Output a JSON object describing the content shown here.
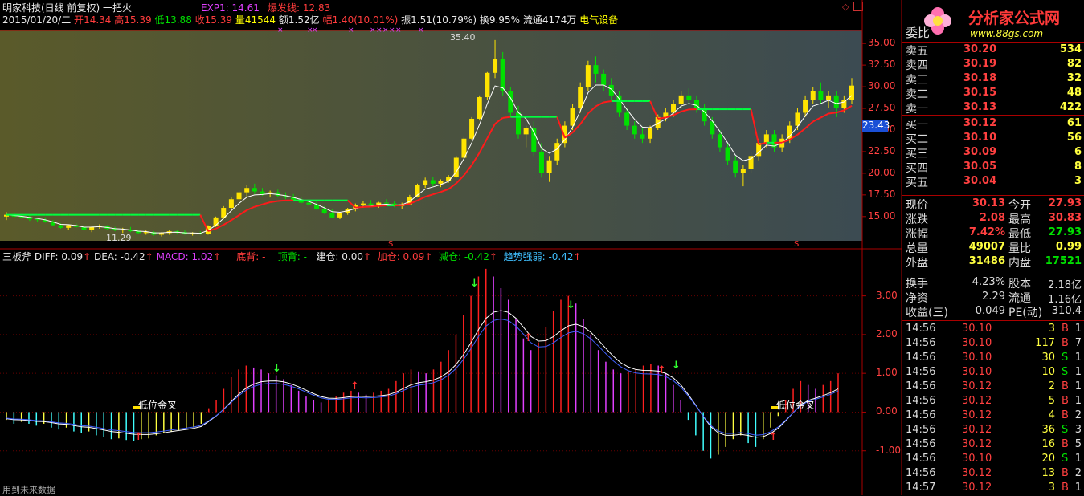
{
  "header": {
    "title": "明家科技(日线 前复权) 一把火",
    "date": "2015/01/20/二",
    "open_label": "开",
    "open": "14.34",
    "high_label": "高",
    "high": "15.39",
    "low_label": "低",
    "low": "13.88",
    "close_label": "收",
    "close": "15.39",
    "vol_label": "量",
    "vol": "41544",
    "amt_label": "额",
    "amt": "1.52亿",
    "chg_label": "幅",
    "chg": "1.40(10.01%)",
    "amp_label": "振",
    "amp": "1.51(10.79%)",
    "turn_label": "换",
    "turn": "9.95%",
    "float_label": "流通",
    "float": "4174万",
    "sector": "电气设备",
    "exp1": "EXP1: 14.61",
    "burst": "爆发线: 12.83"
  },
  "price_chart": {
    "y_ticks": [
      "35.00",
      "32.50",
      "30.00",
      "27.50",
      "25.00",
      "22.50",
      "20.00",
      "17.50",
      "15.00"
    ],
    "current_tag": "23.43",
    "max_label": "35.40",
    "min_label": "11.29",
    "candles": [
      [
        15,
        15.5,
        14.6,
        15.2
      ],
      [
        15.2,
        15.5,
        14.8,
        15
      ],
      [
        15,
        15.3,
        14.7,
        14.9
      ],
      [
        14.9,
        15.1,
        14.5,
        14.7
      ],
      [
        14.7,
        14.9,
        14.4,
        14.6
      ],
      [
        14.6,
        14.9,
        14.3,
        14.4
      ],
      [
        14.4,
        14.6,
        13.9,
        14.0
      ],
      [
        14,
        14.2,
        13.6,
        13.7
      ],
      [
        13.7,
        14.1,
        13.5,
        14.0
      ],
      [
        14,
        14.2,
        13.7,
        13.8
      ],
      [
        13.8,
        14.0,
        13.4,
        13.5
      ],
      [
        13.5,
        13.9,
        13.2,
        13.8
      ],
      [
        13.8,
        14.1,
        13.6,
        13.9
      ],
      [
        13.9,
        14.0,
        13.5,
        13.6
      ],
      [
        13.6,
        13.8,
        13.3,
        13.4
      ],
      [
        13.4,
        13.7,
        13.1,
        13.5
      ],
      [
        13.5,
        13.8,
        13.2,
        13.3
      ],
      [
        13.3,
        13.5,
        13.0,
        13.1
      ],
      [
        13.1,
        13.4,
        12.9,
        13.2
      ],
      [
        13.2,
        13.3,
        12.8,
        12.9
      ],
      [
        12.9,
        13.2,
        12.7,
        13.1
      ],
      [
        13.1,
        13.4,
        12.9,
        13.3
      ],
      [
        13.3,
        13.5,
        13.0,
        13.2
      ],
      [
        13.2,
        13.4,
        12.9,
        13.0
      ],
      [
        13,
        13.2,
        12.8,
        13.1
      ],
      [
        13.1,
        13.3,
        12.9,
        13.0
      ],
      [
        13.0,
        14.0,
        12.9,
        13.9
      ],
      [
        13.9,
        15.0,
        13.8,
        14.9
      ],
      [
        14.9,
        16.2,
        14.7,
        16.0
      ],
      [
        16,
        17.2,
        15.8,
        17.0
      ],
      [
        17,
        18.0,
        16.5,
        17.8
      ],
      [
        17.8,
        18.6,
        17.2,
        18.3
      ],
      [
        18.3,
        18.8,
        17.6,
        17.9
      ],
      [
        17.9,
        18.3,
        17.4,
        17.6
      ],
      [
        17.6,
        18.0,
        17.2,
        17.8
      ],
      [
        17.8,
        18.1,
        17.3,
        17.4
      ],
      [
        17.4,
        17.8,
        17.0,
        17.2
      ],
      [
        17.2,
        17.6,
        16.8,
        16.9
      ],
      [
        16.9,
        17.3,
        16.5,
        16.6
      ],
      [
        16.6,
        17.0,
        16.2,
        16.4
      ],
      [
        16.4,
        16.8,
        15.8,
        15.9
      ],
      [
        15.9,
        16.2,
        15.3,
        15.4
      ],
      [
        15.4,
        15.8,
        14.8,
        14.9
      ],
      [
        14.9,
        15.5,
        14.7,
        15.4
      ],
      [
        15.4,
        16.0,
        15.2,
        15.9
      ],
      [
        15.9,
        16.5,
        15.6,
        16.3
      ],
      [
        16.3,
        16.8,
        16.0,
        16.5
      ],
      [
        16.5,
        16.9,
        16.1,
        16.3
      ],
      [
        16.3,
        16.7,
        16.0,
        16.6
      ],
      [
        16.6,
        17.0,
        16.3,
        16.5
      ],
      [
        16.5,
        16.8,
        16.1,
        16.2
      ],
      [
        16.2,
        16.6,
        15.9,
        16.4
      ],
      [
        16.4,
        17.5,
        16.3,
        17.3
      ],
      [
        17.3,
        18.8,
        17.2,
        18.6
      ],
      [
        18.6,
        19.5,
        18.3,
        19.2
      ],
      [
        19.2,
        19.6,
        18.5,
        18.8
      ],
      [
        18.8,
        19.3,
        18.4,
        19.1
      ],
      [
        19.1,
        19.8,
        18.9,
        19.6
      ],
      [
        19.6,
        22.0,
        19.5,
        21.8
      ],
      [
        21.8,
        24.2,
        21.6,
        24.0
      ],
      [
        24,
        26.5,
        23.8,
        26.3
      ],
      [
        26.3,
        29.0,
        26.1,
        28.8
      ],
      [
        28.8,
        31.7,
        28.5,
        31.6
      ],
      [
        31.6,
        35.4,
        31.0,
        33.2
      ],
      [
        33.2,
        34.0,
        29.0,
        29.5
      ],
      [
        29.5,
        30.0,
        26.5,
        27.0
      ],
      [
        27,
        27.8,
        24.0,
        24.5
      ],
      [
        24.5,
        25.5,
        23.0,
        25.2
      ],
      [
        25.2,
        26.0,
        22.0,
        22.5
      ],
      [
        22.5,
        23.5,
        19.5,
        20.0
      ],
      [
        20,
        22.0,
        19.0,
        21.5
      ],
      [
        21.5,
        24.0,
        21.0,
        23.5
      ],
      [
        23.5,
        26.0,
        23.0,
        25.5
      ],
      [
        25.5,
        28.0,
        25.0,
        27.5
      ],
      [
        27.5,
        30.5,
        27.0,
        30.0
      ],
      [
        30,
        33.0,
        29.5,
        32.5
      ],
      [
        32.5,
        33.5,
        30.5,
        31.5
      ],
      [
        31.5,
        32.0,
        29.5,
        30.2
      ],
      [
        30.2,
        31.0,
        28.5,
        29.0
      ],
      [
        29,
        29.5,
        26.5,
        27.0
      ],
      [
        27,
        27.5,
        25.0,
        25.5
      ],
      [
        25.5,
        26.0,
        24.0,
        24.5
      ],
      [
        24.5,
        25.2,
        23.5,
        24.0
      ],
      [
        24,
        25.5,
        23.5,
        25.2
      ],
      [
        25.2,
        26.8,
        25.0,
        26.5
      ],
      [
        26.5,
        27.5,
        26.0,
        27.0
      ],
      [
        27,
        28.5,
        26.5,
        28.0
      ],
      [
        28,
        29.5,
        27.5,
        29.0
      ],
      [
        29,
        29.8,
        28.0,
        28.5
      ],
      [
        28.5,
        29.0,
        27.0,
        27.5
      ],
      [
        27.5,
        28.0,
        25.5,
        26.0
      ],
      [
        26,
        26.5,
        24.0,
        24.5
      ],
      [
        24.5,
        25.0,
        22.5,
        23.0
      ],
      [
        23,
        23.5,
        21.0,
        21.5
      ],
      [
        21.5,
        22.0,
        19.5,
        20.0
      ],
      [
        20,
        21.0,
        18.5,
        20.5
      ],
      [
        20.5,
        22.5,
        20.0,
        22.0
      ],
      [
        22,
        24.0,
        21.5,
        23.5
      ],
      [
        23.5,
        25.0,
        23.0,
        24.5
      ],
      [
        24.5,
        25.0,
        22.5,
        23.0
      ],
      [
        23,
        24.5,
        22.5,
        24.0
      ],
      [
        24,
        26.0,
        23.5,
        25.5
      ],
      [
        25.5,
        27.5,
        25.0,
        27.0
      ],
      [
        27,
        29.0,
        26.5,
        28.5
      ],
      [
        28.5,
        30.0,
        28.0,
        29.5
      ],
      [
        29.5,
        30.5,
        28.0,
        28.5
      ],
      [
        28.5,
        29.5,
        27.5,
        29.0
      ],
      [
        29,
        29.5,
        26.5,
        27.5
      ],
      [
        27.5,
        29.0,
        27.0,
        28.5
      ],
      [
        28.5,
        31.0,
        28.0,
        30.13
      ]
    ]
  },
  "indicator": {
    "name": "三板斧",
    "diff": "DIFF: 0.09",
    "dea": "DEA: -0.42",
    "macd": "MACD: 1.02",
    "bottom_div": "底背: -",
    "top_div": "顶背: -",
    "build": "建仓: 0.00",
    "add": "加仓: 0.09",
    "cut": "减仓: -0.42",
    "trend": "趋势强弱: -0.42",
    "y_ticks": [
      "3.00",
      "2.00",
      "1.00",
      "0.00",
      "-1.00"
    ],
    "label_low_cross1": "低位金叉",
    "label_low_cross2": "低位金叉",
    "footer_note": "用到未来数据",
    "macd_bars": [
      -0.2,
      -0.3,
      -0.25,
      -0.3,
      -0.35,
      -0.3,
      -0.4,
      -0.45,
      -0.4,
      -0.5,
      -0.55,
      -0.5,
      -0.6,
      -0.65,
      -0.7,
      -0.68,
      -0.72,
      -0.75,
      -0.7,
      -0.68,
      -0.6,
      -0.55,
      -0.5,
      -0.48,
      -0.45,
      -0.4,
      -0.3,
      0.1,
      0.3,
      0.6,
      0.9,
      1.1,
      1.2,
      1.15,
      1.1,
      1.0,
      0.95,
      0.85,
      0.7,
      0.55,
      0.4,
      0.3,
      0.25,
      0.3,
      0.4,
      0.5,
      0.55,
      0.5,
      0.45,
      0.5,
      0.55,
      0.6,
      0.8,
      1.0,
      1.1,
      1.05,
      1.0,
      1.1,
      1.3,
      1.6,
      2.0,
      2.5,
      3.0,
      3.5,
      3.7,
      3.5,
      3.2,
      2.9,
      2.4,
      1.9,
      1.6,
      1.8,
      2.2,
      2.6,
      2.9,
      3.0,
      2.8,
      2.4,
      2.0,
      1.6,
      1.3,
      1.1,
      1.0,
      1.05,
      1.1,
      1.2,
      1.25,
      1.2,
      1.0,
      0.7,
      0.3,
      -0.2,
      -0.6,
      -1.0,
      -1.2,
      -1.1,
      -0.9,
      -0.7,
      -0.6,
      -0.8,
      -0.9,
      -0.7,
      -0.4,
      -0.1,
      0.3,
      0.6,
      0.8,
      0.7,
      0.6,
      0.7,
      0.8,
      1.0
    ]
  },
  "quote": {
    "header_label": "委比",
    "rows": [
      {
        "label": "卖五",
        "price": "30.20",
        "vol": "534"
      },
      {
        "label": "卖四",
        "price": "30.19",
        "vol": "82"
      },
      {
        "label": "卖三",
        "price": "30.18",
        "vol": "32"
      },
      {
        "label": "卖二",
        "price": "30.15",
        "vol": "48"
      },
      {
        "label": "卖一",
        "price": "30.13",
        "vol": "422"
      },
      {
        "label": "买一",
        "price": "30.12",
        "vol": "61"
      },
      {
        "label": "买二",
        "price": "30.10",
        "vol": "56"
      },
      {
        "label": "买三",
        "price": "30.09",
        "vol": "6"
      },
      {
        "label": "买四",
        "price": "30.05",
        "vol": "8"
      },
      {
        "label": "买五",
        "price": "30.04",
        "vol": "3"
      }
    ],
    "stats": [
      {
        "l1": "现价",
        "v1": "30.13",
        "l2": "今开",
        "v2": "27.93"
      },
      {
        "l1": "涨跌",
        "v1": "2.08",
        "l2": "最高",
        "v2": "30.83"
      },
      {
        "l1": "涨幅",
        "v1": "7.42%",
        "l2": "最低",
        "v2": "27.93"
      },
      {
        "l1": "总量",
        "v1": "49007",
        "l2": "量比",
        "v2": "0.99"
      },
      {
        "l1": "外盘",
        "v1": "31486",
        "l2": "内盘",
        "v2": "17521"
      }
    ],
    "stats2": [
      {
        "l1": "换手",
        "v1": "4.23%",
        "l2": "股本",
        "v2": "2.18亿"
      },
      {
        "l1": "净资",
        "v1": "2.29",
        "l2": "流通",
        "v2": "1.16亿"
      },
      {
        "l1": "收益(三)",
        "v1": "0.049",
        "l2": "PE(动)",
        "v2": "310.4"
      }
    ],
    "ticks": [
      {
        "t": "14:56",
        "p": "30.10",
        "v": "3",
        "s": "B",
        "n": "1"
      },
      {
        "t": "14:56",
        "p": "30.10",
        "v": "117",
        "s": "B",
        "n": "7"
      },
      {
        "t": "14:56",
        "p": "30.10",
        "v": "30",
        "s": "S",
        "n": "1"
      },
      {
        "t": "14:56",
        "p": "30.10",
        "v": "10",
        "s": "S",
        "n": "1"
      },
      {
        "t": "14:56",
        "p": "30.12",
        "v": "2",
        "s": "B",
        "n": "1"
      },
      {
        "t": "14:56",
        "p": "30.12",
        "v": "5",
        "s": "B",
        "n": "1"
      },
      {
        "t": "14:56",
        "p": "30.12",
        "v": "4",
        "s": "B",
        "n": "2"
      },
      {
        "t": "14:56",
        "p": "30.12",
        "v": "36",
        "s": "S",
        "n": "3"
      },
      {
        "t": "14:56",
        "p": "30.12",
        "v": "16",
        "s": "B",
        "n": "5"
      },
      {
        "t": "14:56",
        "p": "30.10",
        "v": "20",
        "s": "S",
        "n": "1"
      },
      {
        "t": "14:56",
        "p": "30.12",
        "v": "13",
        "s": "B",
        "n": "2"
      },
      {
        "t": "14:57",
        "p": "30.12",
        "v": "3",
        "s": "B",
        "n": "1"
      }
    ],
    "logo_text": "分析家公式网",
    "logo_url": "www.88gs.com"
  },
  "colors": {
    "up": "#ff3c3c",
    "down": "#00e000",
    "text": "#e8e8e8",
    "axis": "#a00000"
  }
}
